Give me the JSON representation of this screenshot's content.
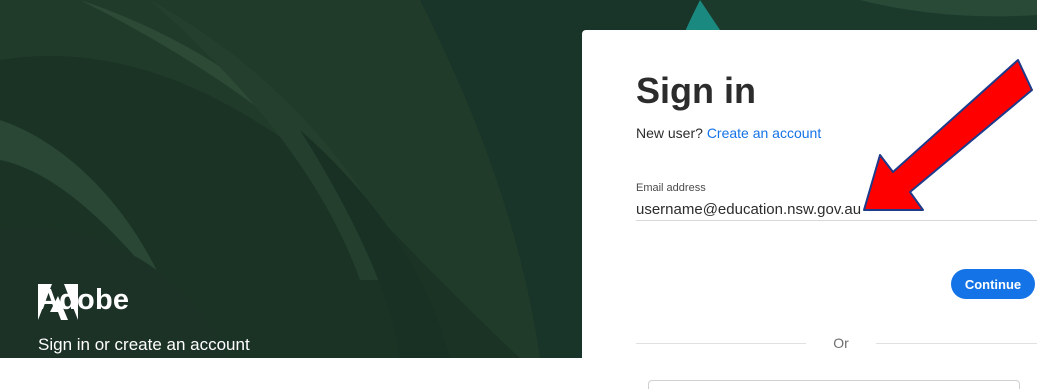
{
  "brand": {
    "name": "Adobe",
    "tagline": "Sign in or create an account",
    "logo_icon": "adobe-logo-icon"
  },
  "signin": {
    "title": "Sign in",
    "new_user_text": "New user?",
    "create_account_link": "Create an account",
    "email_label": "Email address",
    "email_value": "username@education.nsw.gov.au",
    "continue_label": "Continue",
    "divider_text": "Or"
  },
  "annotation": {
    "arrow_icon": "red-arrow-icon",
    "arrow_color": "#ff0000"
  },
  "colors": {
    "accent": "#1473e6",
    "leaf_dark": "#1f3a2c",
    "teal": "#1d8a80"
  }
}
